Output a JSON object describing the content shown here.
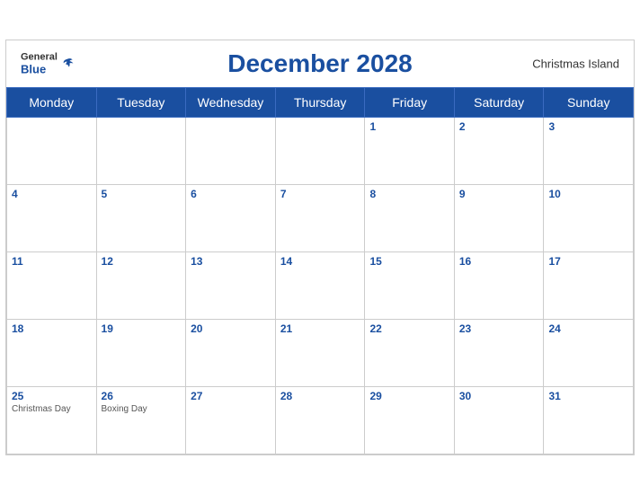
{
  "header": {
    "logo": {
      "general": "General",
      "blue": "Blue"
    },
    "title": "December 2028",
    "region": "Christmas Island"
  },
  "weekdays": [
    "Monday",
    "Tuesday",
    "Wednesday",
    "Thursday",
    "Friday",
    "Saturday",
    "Sunday"
  ],
  "weeks": [
    [
      {
        "day": "",
        "events": []
      },
      {
        "day": "",
        "events": []
      },
      {
        "day": "",
        "events": []
      },
      {
        "day": "",
        "events": []
      },
      {
        "day": "1",
        "events": []
      },
      {
        "day": "2",
        "events": []
      },
      {
        "day": "3",
        "events": []
      }
    ],
    [
      {
        "day": "4",
        "events": []
      },
      {
        "day": "5",
        "events": []
      },
      {
        "day": "6",
        "events": []
      },
      {
        "day": "7",
        "events": []
      },
      {
        "day": "8",
        "events": []
      },
      {
        "day": "9",
        "events": []
      },
      {
        "day": "10",
        "events": []
      }
    ],
    [
      {
        "day": "11",
        "events": []
      },
      {
        "day": "12",
        "events": []
      },
      {
        "day": "13",
        "events": []
      },
      {
        "day": "14",
        "events": []
      },
      {
        "day": "15",
        "events": []
      },
      {
        "day": "16",
        "events": []
      },
      {
        "day": "17",
        "events": []
      }
    ],
    [
      {
        "day": "18",
        "events": []
      },
      {
        "day": "19",
        "events": []
      },
      {
        "day": "20",
        "events": []
      },
      {
        "day": "21",
        "events": []
      },
      {
        "day": "22",
        "events": []
      },
      {
        "day": "23",
        "events": []
      },
      {
        "day": "24",
        "events": []
      }
    ],
    [
      {
        "day": "25",
        "events": [
          "Christmas Day"
        ]
      },
      {
        "day": "26",
        "events": [
          "Boxing Day"
        ]
      },
      {
        "day": "27",
        "events": []
      },
      {
        "day": "28",
        "events": []
      },
      {
        "day": "29",
        "events": []
      },
      {
        "day": "30",
        "events": []
      },
      {
        "day": "31",
        "events": []
      }
    ]
  ]
}
